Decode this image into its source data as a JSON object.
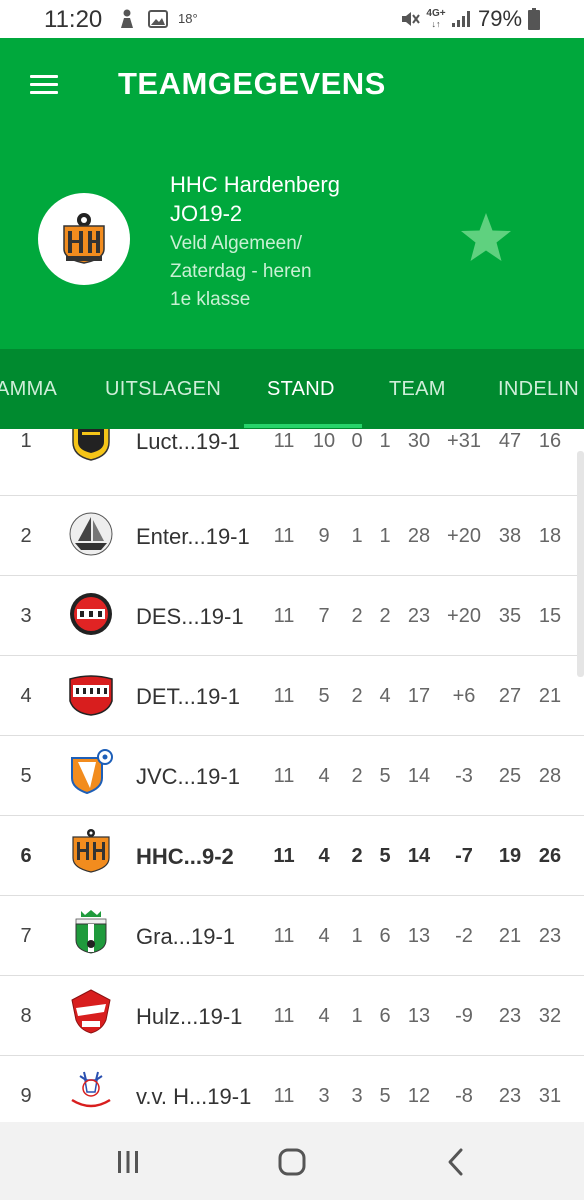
{
  "status_bar": {
    "time": "11:20",
    "temperature": "18°",
    "network": "4G+",
    "battery": "79%"
  },
  "header": {
    "title": "TEAMGEGEVENS",
    "club_name": "HHC Hardenberg",
    "team_name": "JO19-2",
    "competition": "Veld Algemeen/",
    "day_category": "Zaterdag - heren",
    "class": "1e klasse",
    "menu_icon": "hamburger-menu-icon",
    "favorite_icon": "star-icon",
    "accent_color": "#00a83c"
  },
  "tabs": [
    {
      "label": "AMMA",
      "active": false
    },
    {
      "label": "UITSLAGEN",
      "active": false
    },
    {
      "label": "STAND",
      "active": true
    },
    {
      "label": "TEAM",
      "active": false
    },
    {
      "label": "INDELIN",
      "active": false
    }
  ],
  "standings": [
    {
      "pos": "1",
      "team": "Luct...19-1",
      "played": "11",
      "won": "10",
      "drawn": "0",
      "lost": "1",
      "points": "30",
      "goal_diff": "+31",
      "goals_for": "47",
      "goals_against": "16",
      "highlight": false,
      "logo": "crest-icon"
    },
    {
      "pos": "2",
      "team": "Enter...19-1",
      "played": "11",
      "won": "9",
      "drawn": "1",
      "lost": "1",
      "points": "28",
      "goal_diff": "+20",
      "goals_for": "38",
      "goals_against": "18",
      "highlight": false,
      "logo": "ship-icon"
    },
    {
      "pos": "3",
      "team": "DES...19-1",
      "played": "11",
      "won": "7",
      "drawn": "2",
      "lost": "2",
      "points": "23",
      "goal_diff": "+20",
      "goals_for": "35",
      "goals_against": "15",
      "highlight": false,
      "logo": "circle-badge-icon"
    },
    {
      "pos": "4",
      "team": "DET...19-1",
      "played": "11",
      "won": "5",
      "drawn": "2",
      "lost": "4",
      "points": "17",
      "goal_diff": "+6",
      "goals_for": "27",
      "goals_against": "21",
      "highlight": false,
      "logo": "shield-badge-icon"
    },
    {
      "pos": "5",
      "team": "JVC...19-1",
      "played": "11",
      "won": "4",
      "drawn": "2",
      "lost": "5",
      "points": "14",
      "goal_diff": "-3",
      "goals_for": "25",
      "goals_against": "28",
      "highlight": false,
      "logo": "shield-ball-icon"
    },
    {
      "pos": "6",
      "team": "HHC...9-2",
      "played": "11",
      "won": "4",
      "drawn": "2",
      "lost": "5",
      "points": "14",
      "goal_diff": "-7",
      "goals_for": "19",
      "goals_against": "26",
      "highlight": true,
      "logo": "hhc-crest-icon"
    },
    {
      "pos": "7",
      "team": "Gra...19-1",
      "played": "11",
      "won": "4",
      "drawn": "1",
      "lost": "6",
      "points": "13",
      "goal_diff": "-2",
      "goals_for": "21",
      "goals_against": "23",
      "highlight": false,
      "logo": "green-shield-icon"
    },
    {
      "pos": "8",
      "team": "Hulz...19-1",
      "played": "11",
      "won": "4",
      "drawn": "1",
      "lost": "6",
      "points": "13",
      "goal_diff": "-9",
      "goals_for": "23",
      "goals_against": "32",
      "highlight": false,
      "logo": "red-shield-icon"
    },
    {
      "pos": "9",
      "team": "v.v. H...19-1",
      "played": "11",
      "won": "3",
      "drawn": "3",
      "lost": "5",
      "points": "12",
      "goal_diff": "-8",
      "goals_for": "23",
      "goals_against": "31",
      "highlight": false,
      "logo": "deer-icon"
    }
  ],
  "nav_bar": {
    "recent_icon": "recent-apps-icon",
    "home_icon": "home-icon",
    "back_icon": "back-icon"
  }
}
